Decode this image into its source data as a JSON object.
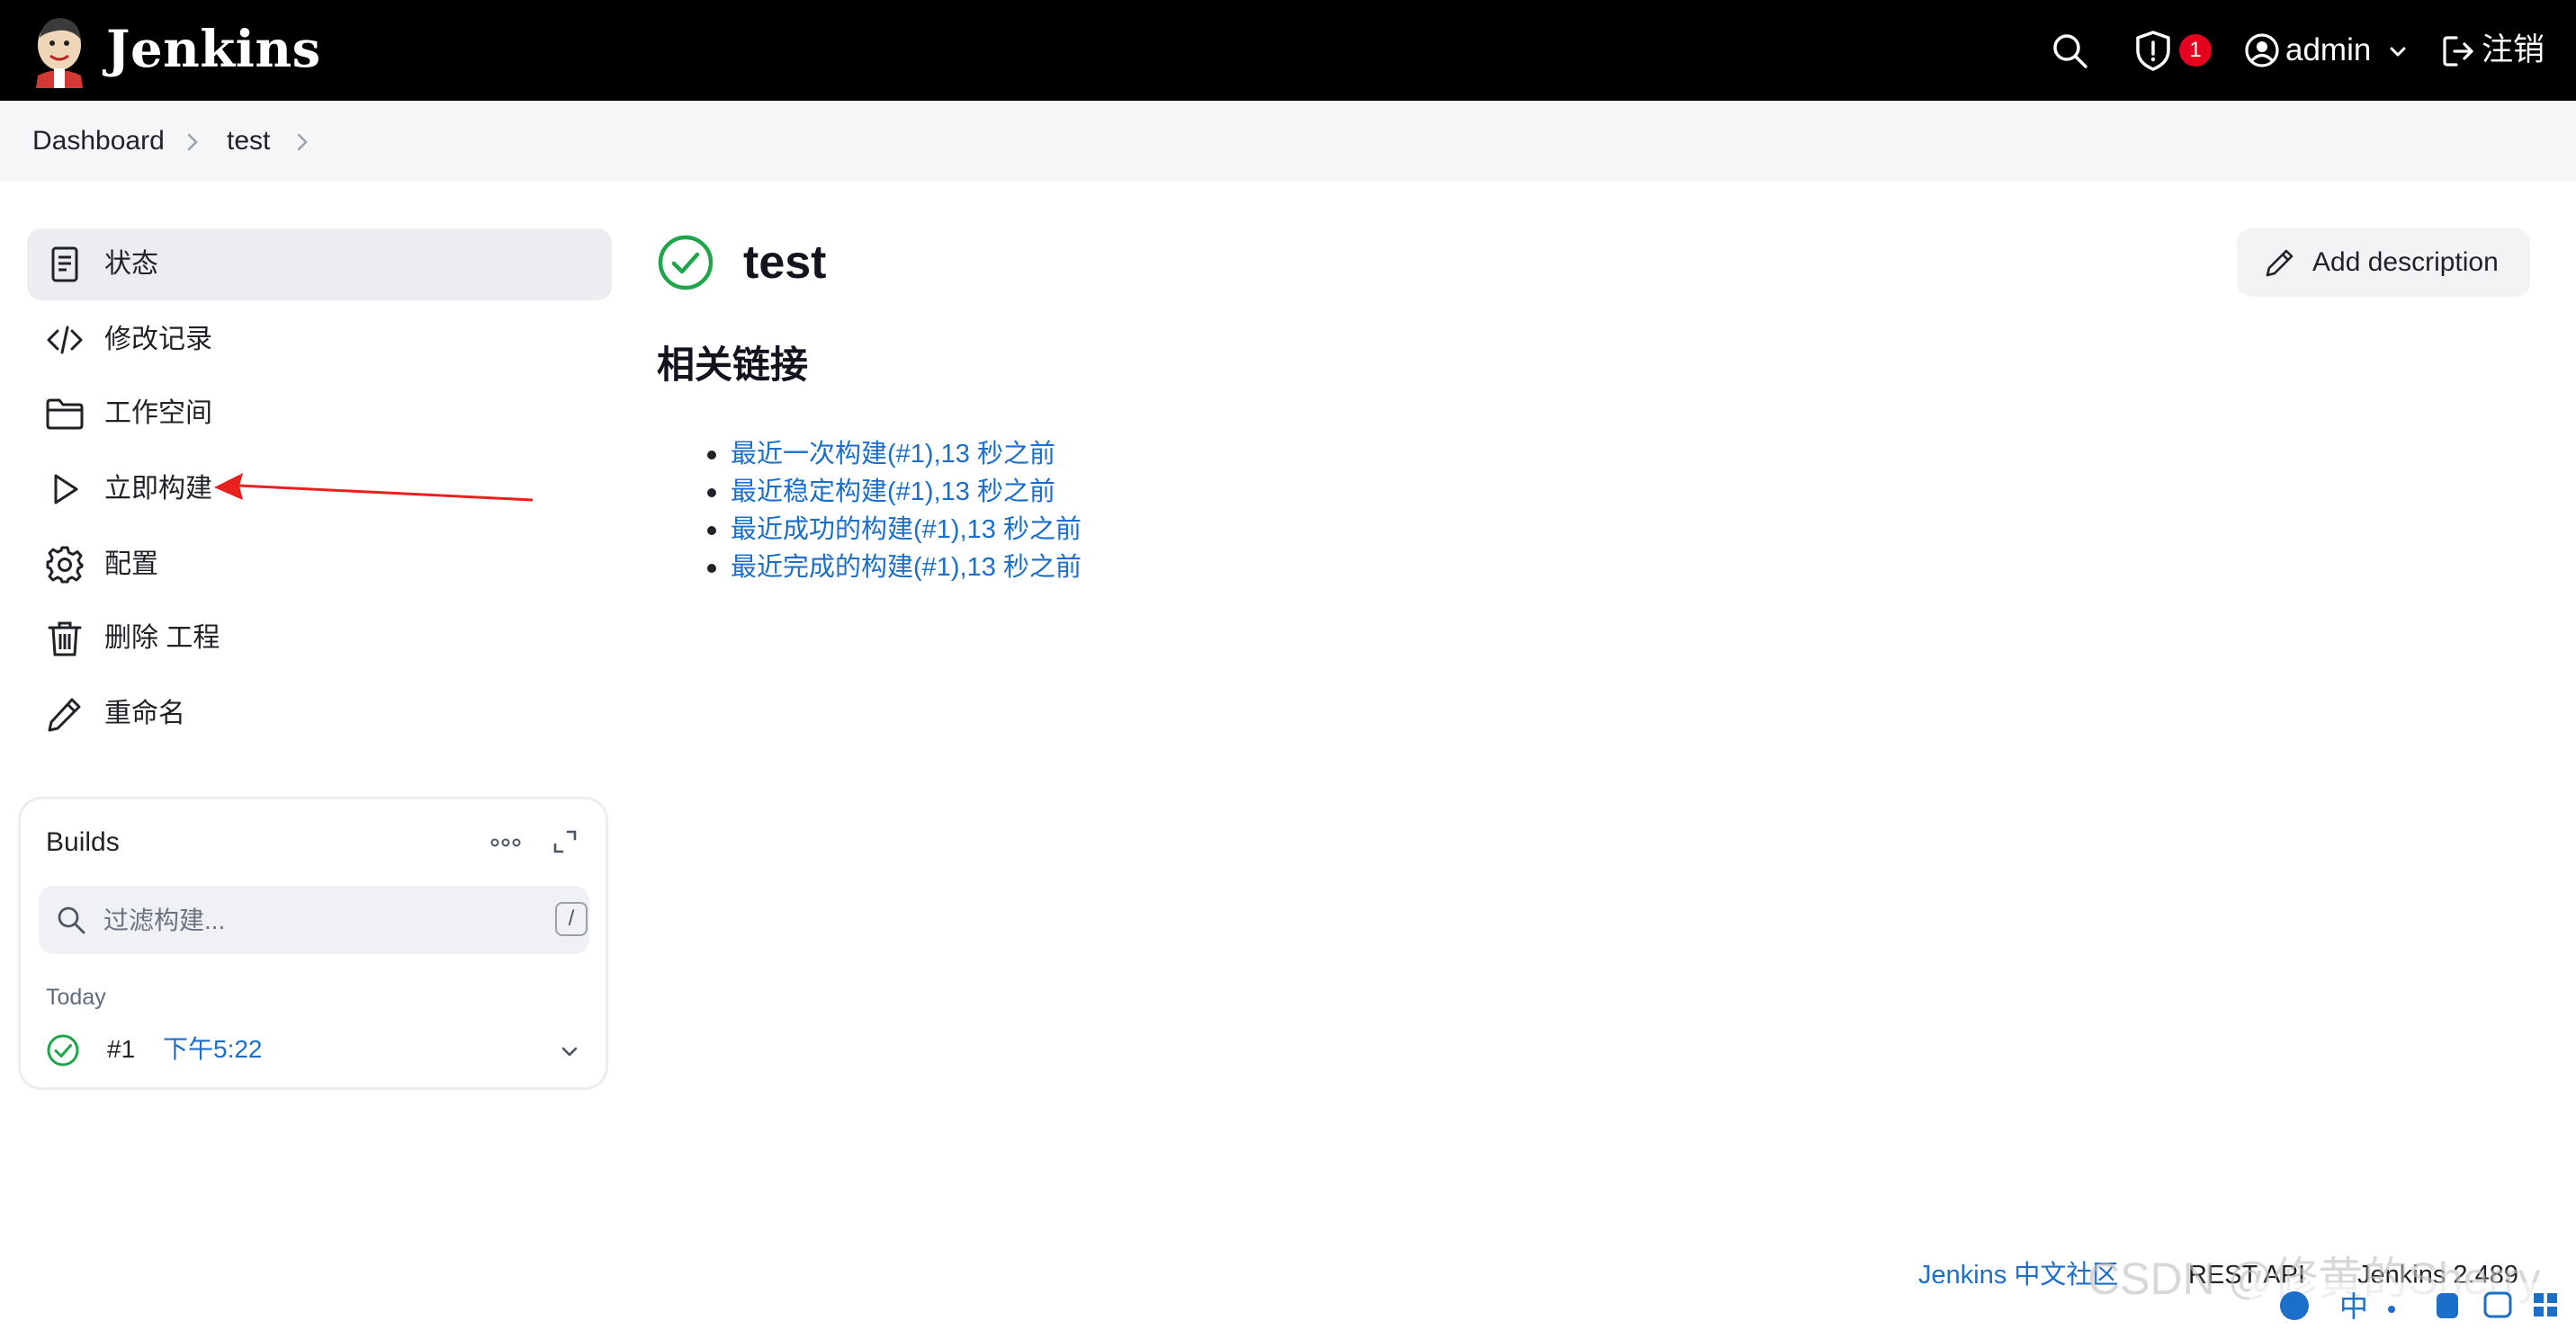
{
  "header": {
    "brand": "Jenkins",
    "security_badge_count": "1",
    "user_name": "admin",
    "logout_label": "注销"
  },
  "breadcrumb": {
    "items": [
      "Dashboard",
      "test"
    ]
  },
  "side_panel": {
    "items": [
      {
        "label": "状态",
        "icon": "document-icon"
      },
      {
        "label": "修改记录",
        "icon": "code-icon"
      },
      {
        "label": "工作空间",
        "icon": "folder-icon"
      },
      {
        "label": "立即构建",
        "icon": "play-icon"
      },
      {
        "label": "配置",
        "icon": "gear-icon"
      },
      {
        "label": "删除 工程",
        "icon": "trash-icon"
      },
      {
        "label": "重命名",
        "icon": "pencil-icon"
      }
    ]
  },
  "builds": {
    "title": "Builds",
    "filter_placeholder": "过滤构建...",
    "filter_shortcut": "/",
    "group_label": "Today",
    "items": [
      {
        "number": "#1",
        "time": "下午5:22",
        "status": "success"
      }
    ]
  },
  "main": {
    "job_title": "test",
    "add_description_label": "Add description",
    "related_heading": "相关链接",
    "links": [
      "最近一次构建(#1),13 秒之前",
      "最近稳定构建(#1),13 秒之前",
      "最近成功的构建(#1),13 秒之前",
      "最近完成的构建(#1),13 秒之前"
    ]
  },
  "footer": {
    "community_link": "Jenkins 中文社区",
    "rest_api": "REST API",
    "version": "Jenkins 2.489"
  },
  "watermark": "CSDN @修黄的Sherry",
  "colors": {
    "header_bg": "#000000",
    "breadcrumb_bg": "#f5f6f8",
    "link": "#1b6fc9",
    "success": "#1ea64a",
    "badge": "#e6001f",
    "annotation_arrow": "#e8201e"
  }
}
